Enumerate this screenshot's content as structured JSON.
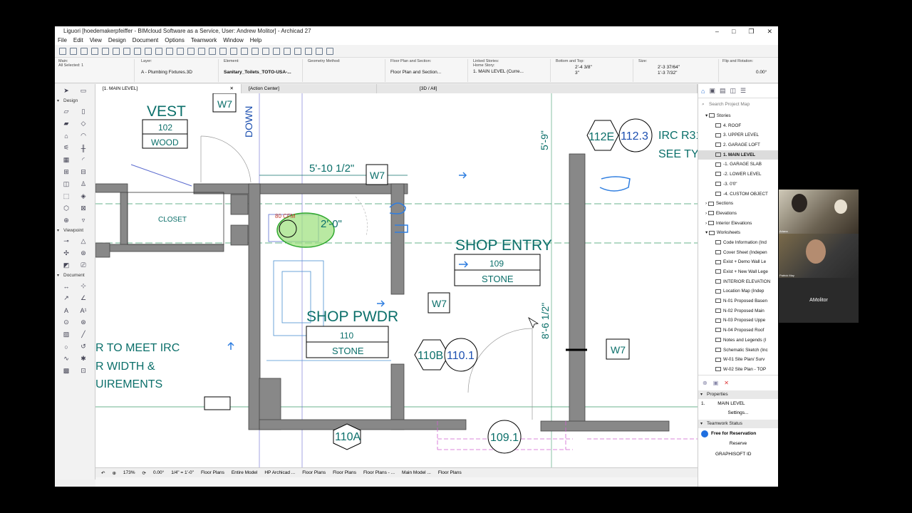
{
  "window": {
    "title": "Liguori [hoedemakerpfeiffer - BIMcloud Software as a Service, User: Andrew Molitor] - Archicad 27",
    "controls": [
      "–",
      "□",
      "❐",
      "✕"
    ]
  },
  "menu": [
    "File",
    "Edit",
    "View",
    "Design",
    "Document",
    "Options",
    "Teamwork",
    "Window",
    "Help"
  ],
  "infobox": {
    "main_label": "Main:",
    "all_selected": "All Selected: 1",
    "layer_label": "Layer:",
    "layer_value": "A - Plumbing Fixtures.3D",
    "element_label": "Element:",
    "element_value": "Sanitary_Toilets_TOTO-USA-...",
    "geometry_label": "Geometry Method:",
    "floorplan_label": "Floor Plan and Section:",
    "floorplan_value": "Floor Plan and Section...",
    "linked_label": "Linked Stories:",
    "home_story_label": "Home Story:",
    "home_story_value": "1. MAIN LEVEL (Curre...",
    "bottom_top_label": "Bottom and Top:",
    "bottom_val": "2'-4 3/8\"",
    "top_val": "3\"",
    "size_label": "Size:",
    "size_w": "2'-3 37/64\"",
    "size_h": "1'-3 7/32\"",
    "flip_label": "Flip and Rotation:",
    "rotation_val": "0.00°"
  },
  "tabs": [
    {
      "label": "[1. MAIN LEVEL]"
    },
    {
      "label": "[Action Center]"
    },
    {
      "label": "[3D / All]"
    }
  ],
  "toolbox": {
    "sections": [
      "Design",
      "Viewpoint",
      "Document"
    ]
  },
  "plan": {
    "vest_title": "VEST",
    "vest_num": "102",
    "vest_mat": "WOOD",
    "down": "DOWN",
    "w7": "W7",
    "dim_top": "5'-10 1/2\"",
    "closet": "CLOSET",
    "cfm": "80 CFM",
    "dim_20": "2'-0\"",
    "shop_entry": "SHOP ENTRY",
    "shop_entry_num": "109",
    "shop_entry_mat": "STONE",
    "shop_pwdr": "SHOP PWDR",
    "shop_pwdr_num": "110",
    "shop_pwdr_mat": "STONE",
    "tag_110b": "110B",
    "tag_1101": "110.1",
    "tag_110a": "110A",
    "tag_1091": "109.1",
    "tag_112e": "112E",
    "tag_1123": "112.3",
    "dim_59": "5'-9\"",
    "dim_86": "8'-6 1/2\"",
    "irc_line1": "IRC R31",
    "irc_line2": "SEE TY",
    "note_line1": "R TO MEET IRC",
    "note_line2": "R WIDTH &",
    "note_line3": "UIREMENTS"
  },
  "statusbar": {
    "zoom": "173%",
    "angle": "0.00°",
    "scale": "1/4\"  =  1'-0\"",
    "items": [
      "Floor Plans",
      "Entire Model",
      "HP Archicad ...",
      "Floor Plans",
      "Floor Plans",
      "Floor Plans - ...",
      "Main Model ...",
      "Floor Plans"
    ]
  },
  "navigator": {
    "search_placeholder": "Search Project Map",
    "stories_label": "Stories",
    "stories": [
      "4. ROOF",
      "3. UPPER LEVEL",
      "2. GARAGE LOFT",
      "1. MAIN LEVEL",
      "-1. GARAGE SLAB",
      "-2. LOWER LEVEL",
      "-3. 0'0\"",
      "-4. CUSTOM OBJECT"
    ],
    "groups": [
      "Sections",
      "Elevations",
      "Interior Elevations",
      "Worksheets"
    ],
    "worksheets": [
      "Code Information (Ind",
      "Cover Sheet (Indepen",
      "Exist + Demo Wall Le",
      "Exist + New Wall Lege",
      "INTERIOR ELEVATION",
      "Location Map (Indep",
      "N-01 Proposed Basen",
      "N-02 Proposed Main",
      "N-03 Proposed Uppe",
      "N-04 Proposed Roof",
      "Notes and Legends (I",
      "Schematic Sketch (Inc",
      "W-01 Site Plan/ Surv",
      "W-02 Site Plan - TOP"
    ],
    "properties_label": "Properties",
    "properties_story": "1.",
    "properties_value": "MAIN LEVEL",
    "settings_label": "Settings...",
    "teamwork_label": "Teamwork Status",
    "reservation": "Free for Reservation",
    "reserve_label": "Reserve",
    "graphisoft": "GRAPHISOFT ID"
  },
  "video": {
    "p1": "Ariana",
    "p2": "Patrick May",
    "p3": "AMolitor"
  }
}
